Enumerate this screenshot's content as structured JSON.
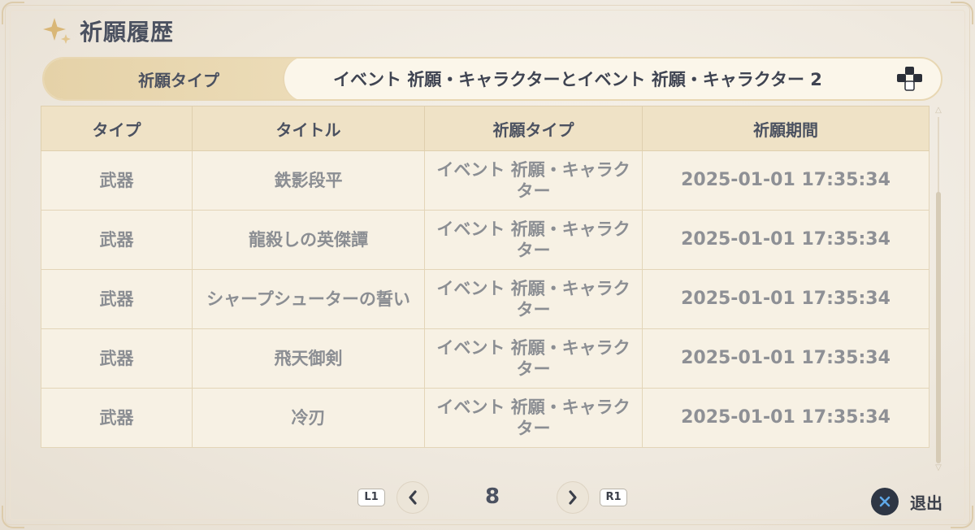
{
  "header": {
    "title": "祈願履歴",
    "icon": "sparkle-icon"
  },
  "filter": {
    "label": "祈願タイプ",
    "value": "イベント 祈願・キャラクターとイベント 祈願・キャラクター 2",
    "icon": "dpad-icon"
  },
  "table": {
    "columns": [
      "タイプ",
      "タイトル",
      "祈願タイプ",
      "祈願期間"
    ],
    "rows": [
      {
        "type": "武器",
        "title": "鉄影段平",
        "wish_type": "イベント 祈願・キャラクター",
        "period": "2025-01-01 17:35:34"
      },
      {
        "type": "武器",
        "title": "龍殺しの英傑譚",
        "wish_type": "イベント 祈願・キャラクター",
        "period": "2025-01-01 17:35:34"
      },
      {
        "type": "武器",
        "title": "シャープシューターの誓い",
        "wish_type": "イベント 祈願・キャラクター",
        "period": "2025-01-01 17:35:34"
      },
      {
        "type": "武器",
        "title": "飛天御剣",
        "wish_type": "イベント 祈願・キャラクター",
        "period": "2025-01-01 17:35:34"
      },
      {
        "type": "武器",
        "title": "冷刃",
        "wish_type": "イベント 祈願・キャラクター",
        "period": "2025-01-01 17:35:34"
      }
    ]
  },
  "pager": {
    "prev_key": "L1",
    "next_key": "R1",
    "page": "8",
    "prev_icon": "chevron-left-icon",
    "next_icon": "chevron-right-icon"
  },
  "exit": {
    "label": "退出",
    "icon": "cross-button-icon"
  },
  "colors": {
    "accent_gold": "#e5d2a8",
    "text_dark": "#4b5160",
    "text_muted": "#8b8e93",
    "cross_button": "#2e3644",
    "cross_symbol": "#5fa8e8"
  }
}
